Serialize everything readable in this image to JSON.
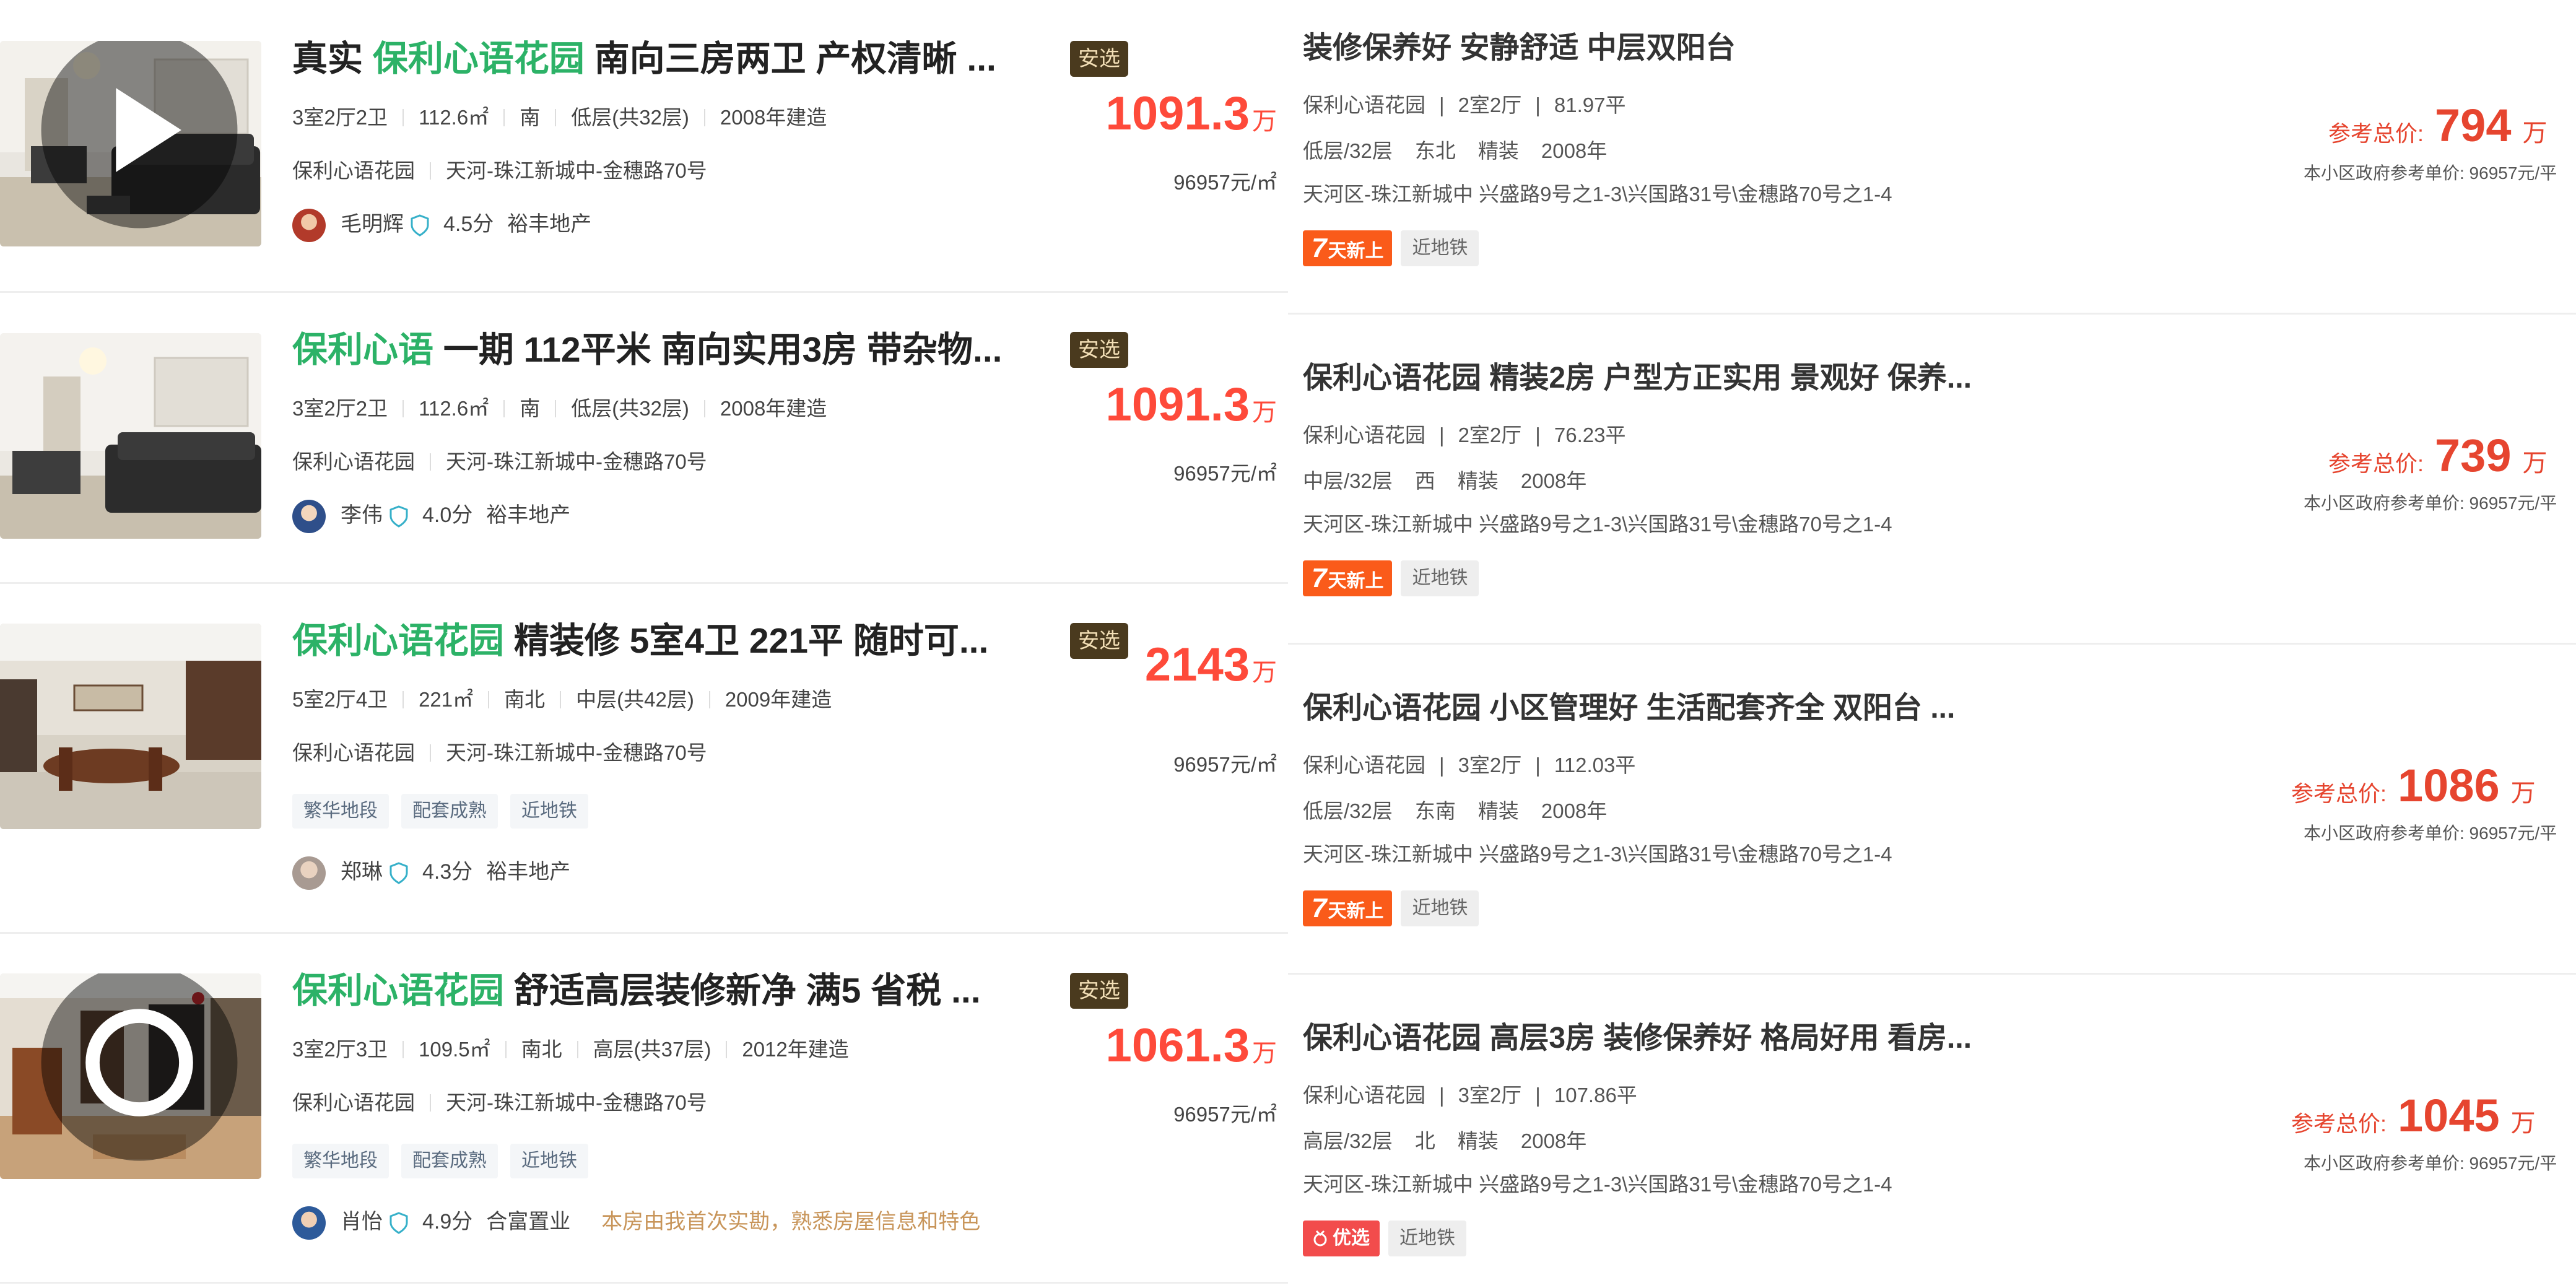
{
  "left_listings": [
    {
      "title_prefix": "真实 ",
      "title_highlight": "保利心语花园",
      "title_rest": " 南向三房两卫 产权清晰 ...",
      "badge": "安选",
      "attrs": [
        "3室2厅2卫",
        "112.6㎡",
        "南",
        "低层(共32层)",
        "2008年建造"
      ],
      "community": "保利心语花园",
      "address": "天河-珠江新城中-金穗路70号",
      "price": "1091.3",
      "price_unit": "万",
      "unit_price": "96957元/㎡",
      "tags": [],
      "agent_name": "毛明辉",
      "agent_score": "4.5分",
      "agent_company": "裕丰地产",
      "agent_note": ""
    },
    {
      "title_prefix": "",
      "title_highlight": "保利心语",
      "title_rest": " 一期 112平米 南向实用3房 带杂物...",
      "badge": "安选",
      "attrs": [
        "3室2厅2卫",
        "112.6㎡",
        "南",
        "低层(共32层)",
        "2008年建造"
      ],
      "community": "保利心语花园",
      "address": "天河-珠江新城中-金穗路70号",
      "price": "1091.3",
      "price_unit": "万",
      "unit_price": "96957元/㎡",
      "tags": [],
      "agent_name": "李伟",
      "agent_score": "4.0分",
      "agent_company": "裕丰地产",
      "agent_note": ""
    },
    {
      "title_prefix": "",
      "title_highlight": "保利心语花园",
      "title_rest": " 精装修 5室4卫 221平 随时可...",
      "badge": "安选",
      "attrs": [
        "5室2厅4卫",
        "221㎡",
        "南北",
        "中层(共42层)",
        "2009年建造"
      ],
      "community": "保利心语花园",
      "address": "天河-珠江新城中-金穗路70号",
      "price": "2143",
      "price_unit": "万",
      "unit_price": "96957元/㎡",
      "tags": [
        "繁华地段",
        "配套成熟",
        "近地铁"
      ],
      "agent_name": "郑琳",
      "agent_score": "4.3分",
      "agent_company": "裕丰地产",
      "agent_note": ""
    },
    {
      "title_prefix": "",
      "title_highlight": "保利心语花园",
      "title_rest": " 舒适高层装修新净 满5 省税 ...",
      "badge": "安选",
      "attrs": [
        "3室2厅3卫",
        "109.5㎡",
        "南北",
        "高层(共37层)",
        "2012年建造"
      ],
      "community": "保利心语花园",
      "address": "天河-珠江新城中-金穗路70号",
      "price": "1061.3",
      "price_unit": "万",
      "unit_price": "96957元/㎡",
      "tags": [
        "繁华地段",
        "配套成熟",
        "近地铁"
      ],
      "agent_name": "肖怡",
      "agent_score": "4.9分",
      "agent_company": "合富置业",
      "agent_note": "本房由我首次实勘，熟悉房屋信息和特色"
    }
  ],
  "right_listings": [
    {
      "title": "装修保养好 安静舒适 中层双阳台",
      "community": "保利心语花园",
      "layout": "2室2厅",
      "area": "81.97平",
      "floor": "低层/32层",
      "orientation": "东北",
      "decoration": "精装",
      "year": "2008年",
      "address": "天河区-珠江新城中  兴盛路9号之1-3\\兴国路31号\\金穗路70号之1-4",
      "tag_primary": "天新上",
      "tag_primary_prefix": "7",
      "tag_secondary": "近地铁",
      "price_label": "参考总价:",
      "price": "794",
      "price_unit": "万",
      "ref_unit_price": "本小区政府参考单价: 96957元/平"
    },
    {
      "title": "保利心语花园 精装2房 户型方正实用 景观好 保养...",
      "community": "保利心语花园",
      "layout": "2室2厅",
      "area": "76.23平",
      "floor": "中层/32层",
      "orientation": "西",
      "decoration": "精装",
      "year": "2008年",
      "address": "天河区-珠江新城中  兴盛路9号之1-3\\兴国路31号\\金穗路70号之1-4",
      "tag_primary": "天新上",
      "tag_primary_prefix": "7",
      "tag_secondary": "近地铁",
      "price_label": "参考总价:",
      "price": "739",
      "price_unit": "万",
      "ref_unit_price": "本小区政府参考单价: 96957元/平"
    },
    {
      "title": "保利心语花园 小区管理好 生活配套齐全 双阳台 ...",
      "community": "保利心语花园",
      "layout": "3室2厅",
      "area": "112.03平",
      "floor": "低层/32层",
      "orientation": "东南",
      "decoration": "精装",
      "year": "2008年",
      "address": "天河区-珠江新城中  兴盛路9号之1-3\\兴国路31号\\金穗路70号之1-4",
      "tag_primary": "天新上",
      "tag_primary_prefix": "7",
      "tag_secondary": "近地铁",
      "price_label": "参考总价:",
      "price": "1086",
      "price_unit": "万",
      "ref_unit_price": "本小区政府参考单价: 96957元/平"
    },
    {
      "title": "保利心语花园 高层3房 装修保养好 格局好用 看房...",
      "community": "保利心语花园",
      "layout": "3室2厅",
      "area": "107.86平",
      "floor": "高层/32层",
      "orientation": "北",
      "decoration": "精装",
      "year": "2008年",
      "address": "天河区-珠江新城中  兴盛路9号之1-3\\兴国路31号\\金穗路70号之1-4",
      "tag_primary": "优选",
      "tag_primary_prefix": "",
      "tag_secondary": "近地铁",
      "price_label": "参考总价:",
      "price": "1045",
      "price_unit": "万",
      "ref_unit_price": "本小区政府参考单价: 96957元/平"
    }
  ],
  "colors": {
    "highlight_green": "#2cb267",
    "price_red": "#fe4a3a",
    "badge_brown": "#4a3a1e",
    "new_tag_orange": "#fa5b1a"
  }
}
